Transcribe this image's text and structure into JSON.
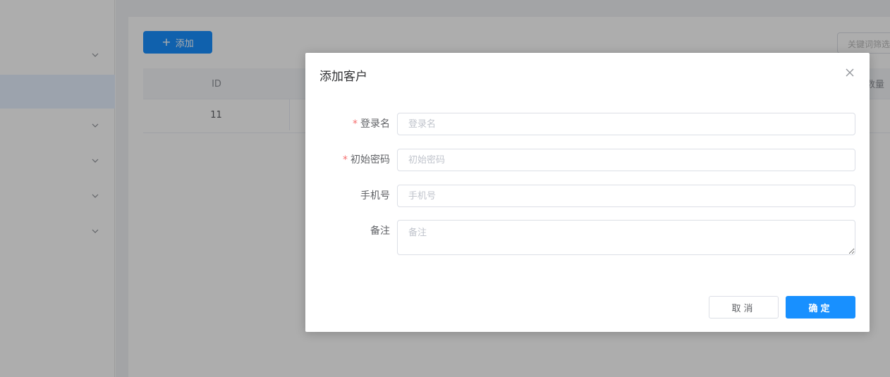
{
  "background": {
    "add_button_label": "添加",
    "keyword_placeholder": "关键词筛选",
    "table": {
      "headers": {
        "id": "ID",
        "qty": "数量"
      },
      "rows": [
        {
          "id": "11"
        }
      ]
    }
  },
  "dialog": {
    "title": "添加客户",
    "fields": {
      "login_name": {
        "label": "登录名",
        "placeholder": "登录名",
        "required": true
      },
      "initial_password": {
        "label": "初始密码",
        "placeholder": "初始密码",
        "required": true
      },
      "phone": {
        "label": "手机号",
        "placeholder": "手机号",
        "required": false
      },
      "remark": {
        "label": "备注",
        "placeholder": "备注",
        "required": false
      }
    },
    "required_mark": "*",
    "cancel_label": "取消",
    "confirm_label": "确定"
  },
  "colors": {
    "primary": "#1890ff",
    "required": "#f56c6c",
    "mask": "rgba(0,0,0,0.32)"
  },
  "icons": {
    "close": "close-icon",
    "chevron": "chevron-down-icon",
    "plus": "plus-icon"
  }
}
